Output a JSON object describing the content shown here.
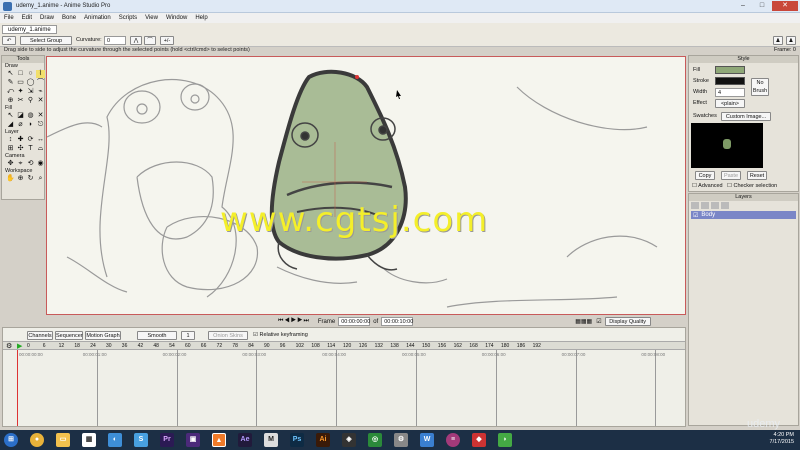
{
  "window": {
    "title": "udemy_1.anime - Anime Studio Pro",
    "buttons": [
      "–",
      "□",
      "✕"
    ]
  },
  "menu": [
    "File",
    "Edit",
    "Draw",
    "Bone",
    "Animation",
    "Scripts",
    "View",
    "Window",
    "Help"
  ],
  "toolbar": {
    "doc_tab": "udemy_1.anime",
    "select_group": "Select Group",
    "curvature_label": "Curvature:",
    "curvature_value": "0",
    "plus_minus": "+/-"
  },
  "hint": "Drag side to side to adjust the curvature through the selected points (hold <ctrl/cmd> to select points)",
  "frame_indicator": "Frame: 0",
  "tools": {
    "title": "Tools",
    "sections": [
      {
        "name": "Draw",
        "icons": [
          "↖",
          "□",
          "○",
          "⌇",
          "✎",
          "▭",
          "◯",
          "⌒",
          "⤺",
          "✦",
          "⇲",
          "⌁",
          "⊕",
          "✂",
          "⚲",
          "✕"
        ]
      },
      {
        "name": "Fill",
        "icons": [
          "↖",
          "◪",
          "◍",
          "✕",
          "◢",
          "⌀",
          "◗",
          "⎋"
        ]
      },
      {
        "name": "Layer",
        "icons": [
          "↕",
          "✚",
          "⟳",
          "↔",
          "⊞",
          "✣",
          "T",
          "⌓"
        ]
      },
      {
        "name": "Camera",
        "icons": [
          "✥",
          "⌖",
          "⟲",
          "◉"
        ]
      },
      {
        "name": "Workspace",
        "icons": [
          "✋",
          "⊕",
          "↻",
          "⌕"
        ]
      }
    ]
  },
  "style": {
    "title": "Style",
    "fill_label": "Fill",
    "fill_color": "#8fa878",
    "stroke_label": "Stroke",
    "stroke_color": "#111111",
    "width_label": "Width",
    "width_value": "4",
    "effect_label": "Effect",
    "effect_value": "<plain>",
    "no_brush": "No Brush",
    "swatches_label": "Swatches",
    "swatches_value": "Custom Image...",
    "copy": "Copy",
    "paste": "Paste",
    "reset": "Reset",
    "advanced": "Advanced",
    "checker": "Checker selection"
  },
  "layers": {
    "title": "Layers",
    "items": [
      {
        "name": "Body"
      }
    ]
  },
  "canvas_controls": {
    "frame_label": "Frame",
    "frame_value": "00:00:00:00",
    "of_label": "of",
    "total_value": "00:00:10:00",
    "display_quality": "Display Quality"
  },
  "timeline": {
    "tabs": [
      "Channels",
      "Sequencer",
      "Motion Graph"
    ],
    "interp": "Smooth",
    "interp_num": "1",
    "onion_skins": "Onion Skins",
    "relative_kf": "Relative keyframing",
    "ruler": [
      "0",
      "6",
      "12",
      "18",
      "24",
      "30",
      "36",
      "42",
      "48",
      "54",
      "60",
      "66",
      "72",
      "78",
      "84",
      "90",
      "96",
      "102",
      "108",
      "114",
      "120",
      "126",
      "132",
      "138",
      "144",
      "150",
      "156",
      "162",
      "168",
      "174",
      "180",
      "186",
      "192"
    ],
    "timecodes": [
      "00:00:00:00",
      "00:00:01:00",
      "00:00:02:00",
      "00:00:03:00",
      "00:00:04:00",
      "00:00:05:00",
      "00:00:06:00",
      "00:00:07:00",
      "00:00:08:00"
    ]
  },
  "watermark": "www.cgtsj.com",
  "udemy_logo": "udemy",
  "taskbar": {
    "apps": [
      "Pr",
      "Ae",
      "M",
      "Ps",
      "Ai"
    ],
    "time": "4:20 PM",
    "date": "7/17/2015"
  }
}
